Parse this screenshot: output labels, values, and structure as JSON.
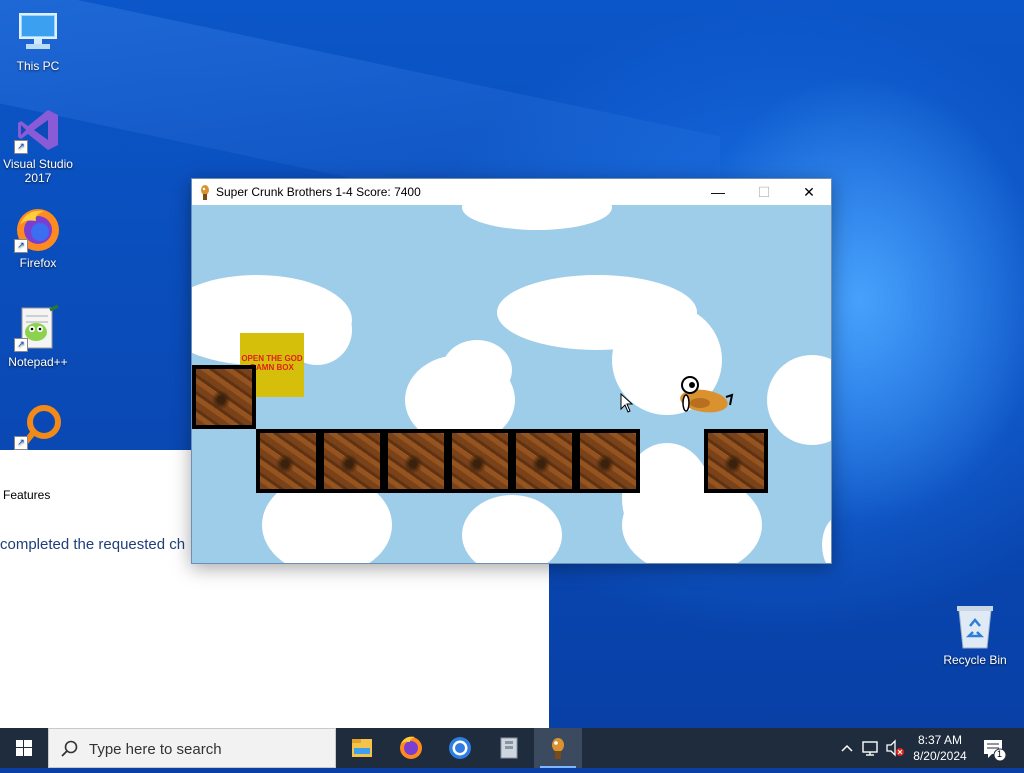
{
  "desktop": {
    "icons": [
      {
        "label": "This PC"
      },
      {
        "label": "Visual Studio 2017"
      },
      {
        "label": "Firefox"
      },
      {
        "label": "Notepad++"
      },
      {
        "label": ""
      },
      {
        "label": "Recycle Bin"
      }
    ]
  },
  "background_window": {
    "features_label": "Features",
    "status_text": "completed the requested ch"
  },
  "game_window": {
    "title": "Super Crunk Brothers 1-4 Score: 7400",
    "minimize_glyph": "—",
    "maximize_glyph": "☐",
    "close_glyph": "✕",
    "question_box_text": "OPEN THE GOD DAMN BOX",
    "colors": {
      "sky": "#9ecdea",
      "box": "#d6bf0a",
      "box_text": "#e0201a",
      "crate": "#7a4218"
    }
  },
  "taskbar": {
    "search_placeholder": "Type here to search",
    "apps": [
      {
        "icon": "file-explorer-icon"
      },
      {
        "icon": "firefox-icon"
      },
      {
        "icon": "chrome-icon"
      },
      {
        "icon": "archive-app-icon"
      },
      {
        "icon": "crunk-game-icon",
        "active": true
      }
    ],
    "clock_time": "8:37 AM",
    "clock_date": "8/20/2024",
    "notification_count": "1"
  }
}
